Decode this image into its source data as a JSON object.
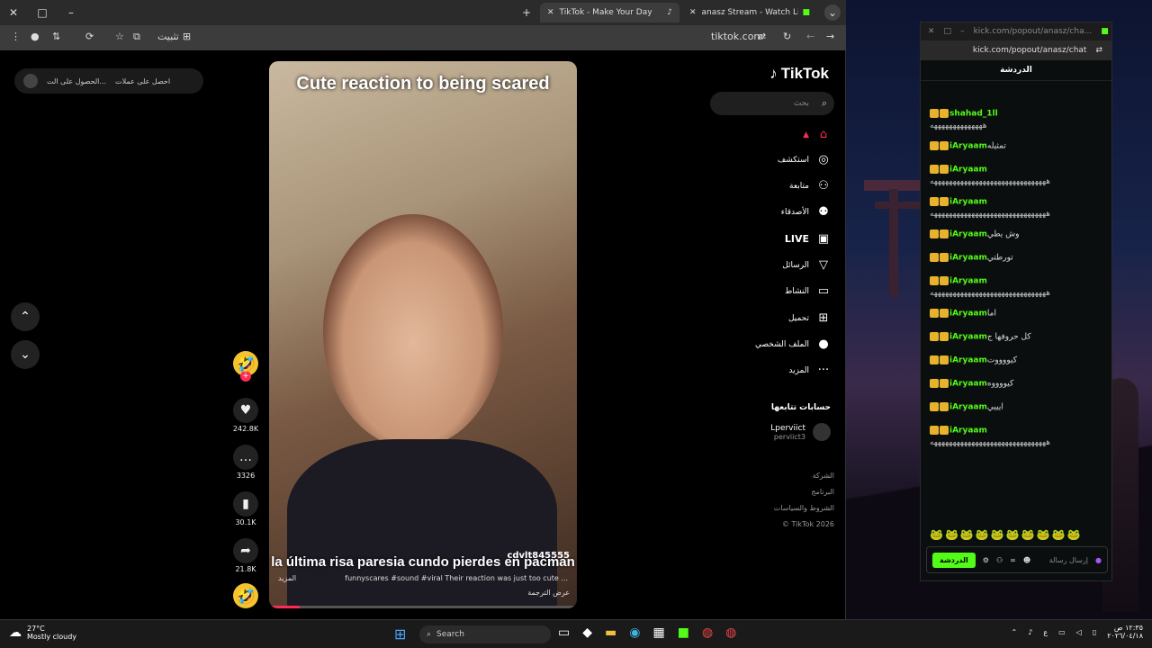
{
  "tabs": {
    "tab1": "TikTok - Make Your Day",
    "tab2": "anasz Stream - Watch Live on K"
  },
  "address": {
    "url": "tiktok.com",
    "install": "تثبيت"
  },
  "overlay": {
    "ad_text": "احصل على عملات",
    "ad_text2": "الحصول على الت..."
  },
  "tiktok": {
    "logo": "TikTok",
    "search": "بحث",
    "nav": [
      "استكشف",
      "متابعة",
      "الأصدقاء",
      "LIVE",
      "الرسائل",
      "النشاط",
      "تحميل",
      "الملف الشخصي",
      "المزيد"
    ],
    "following": "حسابات تتابعها",
    "acc_name": "Lperviict",
    "acc_handle": "perviict3",
    "links": [
      "الشركة",
      "البرنامج",
      "الشروط والسياسات",
      "© TikTok 2026"
    ]
  },
  "video": {
    "title": "Cute reaction to being scared",
    "subtitle": "la última risa paresia cundo pierdes en pacman",
    "author": "cdvlt845555",
    "desc": "funnyscares #sound #viral  Their reaction was just too cute ...",
    "more": "المزيد",
    "translate": "عرض الترجمة",
    "progress": 0.1
  },
  "actions": {
    "likes": "242.8K",
    "comments": "3326",
    "saves": "30.1K",
    "shares": "21.8K"
  },
  "chat": {
    "url": "kick.com/popout/anasz/chat",
    "url_full": "kick.com/popout/anasz/cha...",
    "tab": "الدردشة",
    "send_placeholder": "إرسال رسالة",
    "send_btn": "الدردشة",
    "messages": [
      {
        "user": "shahad_1ll",
        "text": "",
        "sub": "ههههههههههههههه"
      },
      {
        "user": "iAryaam",
        "text": "تمثيله"
      },
      {
        "user": "iAryaam",
        "text": "",
        "sub": "هههههههههههههههههههههههههههههههه"
      },
      {
        "user": "iAryaam",
        "text": "",
        "sub": "هههههههههههههههههههههههههههههههه"
      },
      {
        "user": "iAryaam",
        "text": "وش يطي"
      },
      {
        "user": "iAryaam",
        "text": "تورطتي"
      },
      {
        "user": "iAryaam",
        "text": "",
        "sub": "هههههههههههههههههههههههههههههههه"
      },
      {
        "user": "iAryaam",
        "text": "اما"
      },
      {
        "user": "iAryaam",
        "text": "كل حروفها ج"
      },
      {
        "user": "iAryaam",
        "text": "كيووووت"
      },
      {
        "user": "iAryaam",
        "text": "كيووووه"
      },
      {
        "user": "iAryaam",
        "text": "ايييي"
      },
      {
        "user": "iAryaam",
        "text": "",
        "sub": "هههههههههههههههههههههههههههههههه"
      }
    ]
  },
  "taskbar": {
    "temp": "27°C",
    "weather": "Mostly cloudy",
    "search": "Search",
    "time": "١٢:٣٥ ص",
    "date": "٢٠٢٦/٠٤/١٨",
    "lang": "ع"
  }
}
